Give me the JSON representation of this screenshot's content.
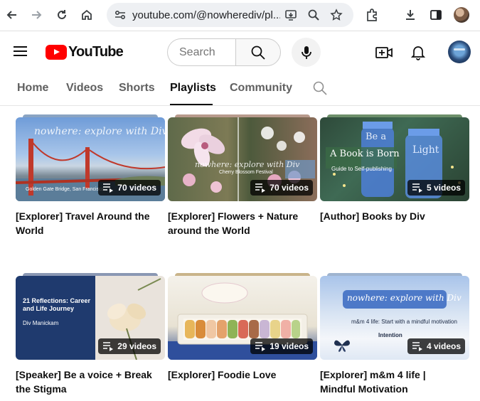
{
  "browser": {
    "url": "youtube.com/@nowherediv/pl..."
  },
  "header": {
    "logo_text": "YouTube",
    "search_placeholder": "Search"
  },
  "tabs": [
    {
      "label": "Home"
    },
    {
      "label": "Videos"
    },
    {
      "label": "Shorts"
    },
    {
      "label": "Playlists",
      "active": true
    },
    {
      "label": "Community"
    }
  ],
  "playlists": [
    {
      "title": "[Explorer] Travel Around the World",
      "count": "70 videos",
      "overlay": "nowhere: explore with Div",
      "caption": "Golden Gate Bridge, San Francisco"
    },
    {
      "title": "[Explorer] Flowers + Nature around the World",
      "count": "70 videos",
      "overlay": "nowhere: explore with Div",
      "caption": "Cherry Blossom Festival"
    },
    {
      "title": "[Author] Books by Div",
      "count": "5 videos",
      "overlay": "A Book is Born",
      "caption": "Guide to Self-publishing",
      "jar_text_1": "Be a",
      "jar_text_2": "Light"
    },
    {
      "title": "[Speaker] Be a voice + Break the Stigma",
      "count": "29 videos",
      "overlay": "21 Reflections: Career and Life Journey",
      "caption": "Div Manickam"
    },
    {
      "title": "[Explorer] Foodie Love",
      "count": "19 videos",
      "overlay": "",
      "caption": ""
    },
    {
      "title": "[Explorer] m&m 4 life | Mindful Motivation",
      "count": "4 videos",
      "overlay": "nowhere: explore with Div",
      "caption": "m&m 4 life: Start with a mindful motivation",
      "tag": "Intention"
    }
  ],
  "colors": {
    "brand_red": "#ff0000",
    "text_primary": "#0f0f0f",
    "text_secondary": "#606060"
  }
}
